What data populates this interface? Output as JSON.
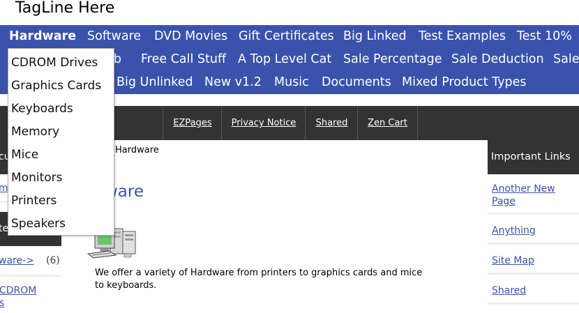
{
  "header": {
    "tagline": "TagLine Here"
  },
  "categories": {
    "row1": [
      "Hardware",
      "Software",
      "DVD Movies",
      "Gift Certificates",
      "Big Linked",
      "Test Examples",
      "Test 10%"
    ],
    "row2": [
      "ib",
      "Free Call Stuff",
      "A Top Level Cat",
      "Sale Percentage",
      "Sale Deduction",
      "Sale"
    ],
    "row3": [
      "Big Unlinked",
      "New v1.2",
      "Music",
      "Documents",
      "Mixed Product Types"
    ],
    "active": "Hardware"
  },
  "dropdown": {
    "items": [
      "CDROM Drives",
      "Graphics Cards",
      "Keyboards",
      "Memory",
      "Mice",
      "Monitors",
      "Printers",
      "Speakers"
    ]
  },
  "ezpages": {
    "links": [
      "EZPages",
      "Privacy Notice",
      "Shared",
      "Zen Cart"
    ]
  },
  "left_sidebar": {
    "head1": "cu",
    "link1": "m",
    "head2": "te",
    "category_link": "ware->",
    "category_count": "(6)",
    "sub_link_line1": "CDROM",
    "sub_link_line2": "s"
  },
  "main": {
    "breadcrumb": "Hardware",
    "title": "ware",
    "description": "We offer a variety of Hardware from printers to graphics cards and mice to keyboards."
  },
  "right_sidebar": {
    "heading": "Important Links",
    "links": [
      "Another New Page",
      "Anything",
      "Site Map",
      "Shared"
    ]
  }
}
